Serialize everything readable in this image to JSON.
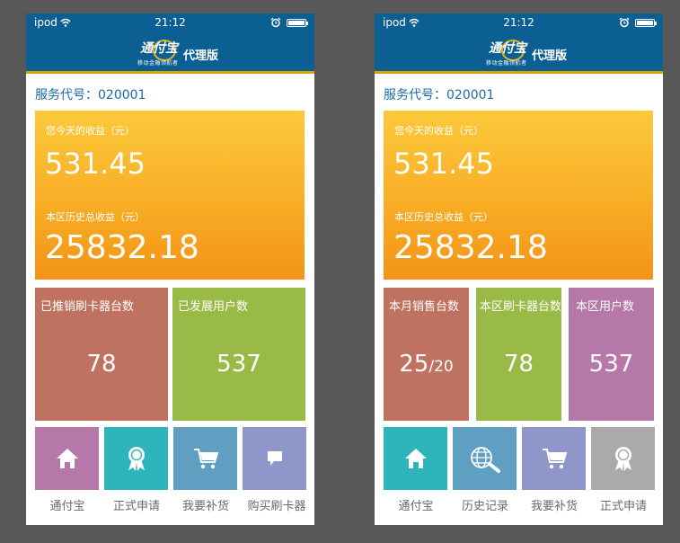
{
  "left": {
    "status": {
      "carrier": "ipod",
      "time": "21:12"
    },
    "header": {
      "logo_text": "通付宝",
      "logo_sub": "移动金融领航者",
      "title": "代理版"
    },
    "service_code": "服务代号：020001",
    "earnings": {
      "today_label": "您今天的收益（元）",
      "today_value": "531.45",
      "total_label": "本区历史总收益（元）",
      "total_value": "25832.18"
    },
    "stats": [
      {
        "label": "已推销刷卡器台数",
        "value": "78"
      },
      {
        "label": "已发展用户数",
        "value": "537"
      }
    ],
    "tiles": [
      {
        "label": "通付宝",
        "icon": "home-icon"
      },
      {
        "label": "正式申请",
        "icon": "award-icon"
      },
      {
        "label": "我要补货",
        "icon": "cart-icon"
      },
      {
        "label": "购买刷卡器",
        "icon": "comment-icon"
      }
    ]
  },
  "right": {
    "status": {
      "carrier": "ipod",
      "time": "21:12"
    },
    "header": {
      "logo_text": "通付宝",
      "logo_sub": "移动金融领航者",
      "title": "代理版"
    },
    "service_code": "服务代号：020001",
    "earnings": {
      "today_label": "您今天的收益（元）",
      "today_value": "531.45",
      "total_label": "本区历史总收益（元）",
      "total_value": "25832.18"
    },
    "stats": [
      {
        "label": "本月销售台数",
        "value": "25",
        "value_suffix": "/20"
      },
      {
        "label": "本区刷卡器台数",
        "value": "78"
      },
      {
        "label": "本区用户数",
        "value": "537"
      }
    ],
    "tiles": [
      {
        "label": "通付宝",
        "icon": "home-icon"
      },
      {
        "label": "历史记录",
        "icon": "globe-search-icon"
      },
      {
        "label": "我要补货",
        "icon": "cart-icon"
      },
      {
        "label": "正式申请",
        "icon": "award-icon"
      }
    ]
  },
  "colors": {
    "header_blue": "#0c5f93",
    "earn_gradient_top": "#fcc93a",
    "earn_gradient_bottom": "#f39418",
    "stat_red": "#c07260",
    "stat_green": "#9aba48",
    "stat_purple": "#b678a8",
    "tile_purple": "#b678a8",
    "tile_teal": "#2eb5bc",
    "tile_steel": "#5fa0c2",
    "tile_lavender": "#8f96c9",
    "tile_gray": "#aaaaaa"
  }
}
